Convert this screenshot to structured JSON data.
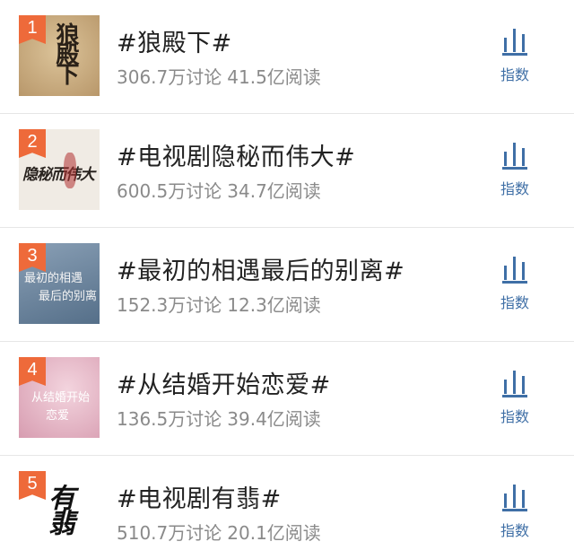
{
  "items": [
    {
      "rank": "1",
      "title": "#狼殿下#",
      "discussions": "306.7万讨论",
      "reads": "41.5亿阅读",
      "index_label": "指数",
      "cover_text": "狼殿下",
      "cover_bg": "#c9ab80"
    },
    {
      "rank": "2",
      "title": "#电视剧隐秘而伟大#",
      "discussions": "600.5万讨论",
      "reads": "34.7亿阅读",
      "index_label": "指数",
      "cover_text": "隐秘而伟大",
      "cover_bg": "#f0ebe4"
    },
    {
      "rank": "3",
      "title": "#最初的相遇最后的别离#",
      "discussions": "152.3万讨论",
      "reads": "12.3亿阅读",
      "index_label": "指数",
      "cover_text": "最初的相遇 最后的别离",
      "cover_bg": "#6e87a0"
    },
    {
      "rank": "4",
      "title": "#从结婚开始恋爱#",
      "discussions": "136.5万讨论",
      "reads": "39.4亿阅读",
      "index_label": "指数",
      "cover_text": "从结婚开始恋爱",
      "cover_bg": "#e5b9c7"
    },
    {
      "rank": "5",
      "title": "#电视剧有翡#",
      "discussions": "510.7万讨论",
      "reads": "20.1亿阅读",
      "index_label": "指数",
      "cover_text": "有翡",
      "cover_bg": "#ffffff"
    }
  ],
  "colors": {
    "rank_badge": "#ee6a3a",
    "index_accent": "#3f6fa6",
    "title": "#222222",
    "meta": "#8a8a8a"
  },
  "icons": {
    "index": "bar-chart-icon"
  }
}
